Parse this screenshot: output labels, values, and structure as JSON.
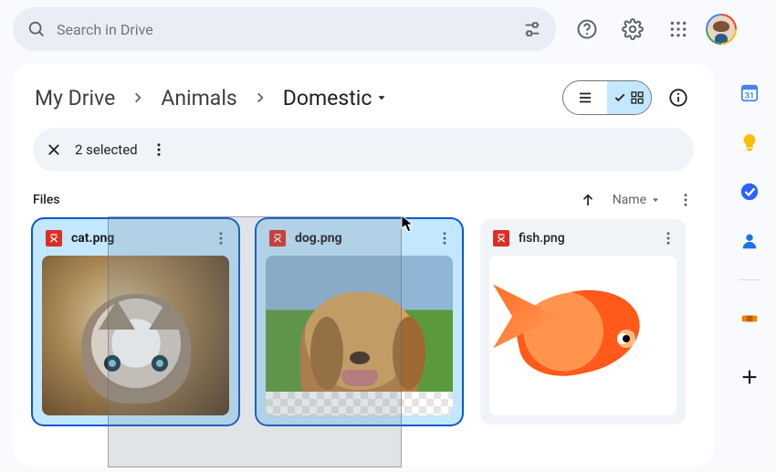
{
  "search": {
    "placeholder": "Search in Drive"
  },
  "breadcrumb": {
    "root": "My Drive",
    "mid": "Animals",
    "current": "Domestic"
  },
  "selection": {
    "count_label": "2 selected"
  },
  "files_section": {
    "label": "Files"
  },
  "sort": {
    "by_label": "Name"
  },
  "files": [
    {
      "name": "cat.png",
      "selected": true,
      "thumb": "cat"
    },
    {
      "name": "dog.png",
      "selected": true,
      "thumb": "dog"
    },
    {
      "name": "fish.png",
      "selected": false,
      "thumb": "fish"
    }
  ],
  "colors": {
    "accent": "#0b57d0",
    "selected_bg": "#c2e7ff",
    "image_badge": "#d93025"
  }
}
